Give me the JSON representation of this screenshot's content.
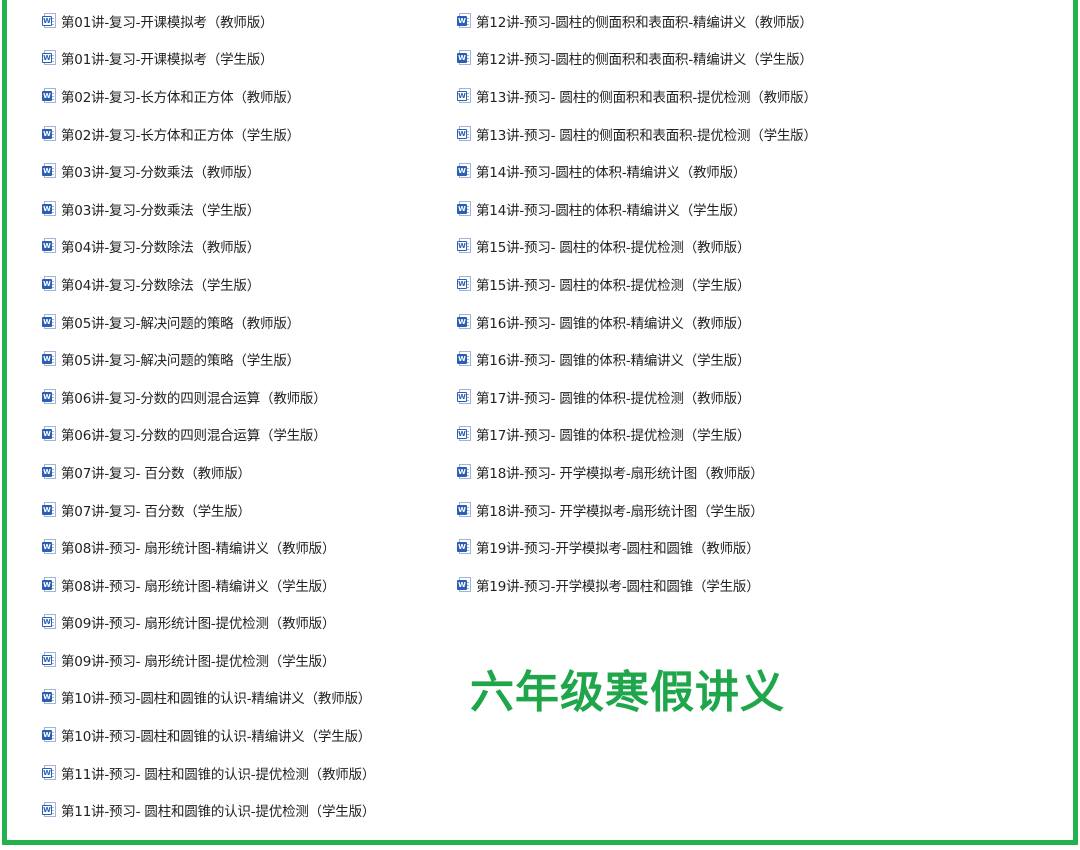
{
  "frame": {
    "border_color": "#22b14c"
  },
  "headline": {
    "text": "六年级寒假讲义",
    "color": "#1fa64a"
  },
  "files": {
    "left": [
      {
        "name": "第01讲-复习-开课模拟考（教师版）",
        "icon": "word-doc-icon-light"
      },
      {
        "name": "第01讲-复习-开课模拟考（学生版）",
        "icon": "word-doc-icon-light"
      },
      {
        "name": "第02讲-复习-长方体和正方体（教师版）",
        "icon": "word-doc-icon"
      },
      {
        "name": "第02讲-复习-长方体和正方体（学生版）",
        "icon": "word-doc-icon"
      },
      {
        "name": "第03讲-复习-分数乘法（教师版）",
        "icon": "word-doc-icon"
      },
      {
        "name": "第03讲-复习-分数乘法（学生版）",
        "icon": "word-doc-icon"
      },
      {
        "name": "第04讲-复习-分数除法（教师版）",
        "icon": "word-doc-icon"
      },
      {
        "name": "第04讲-复习-分数除法（学生版）",
        "icon": "word-doc-icon"
      },
      {
        "name": "第05讲-复习-解决问题的策略（教师版）",
        "icon": "word-doc-icon"
      },
      {
        "name": "第05讲-复习-解决问题的策略（学生版）",
        "icon": "word-doc-icon"
      },
      {
        "name": "第06讲-复习-分数的四则混合运算（教师版）",
        "icon": "word-doc-icon"
      },
      {
        "name": "第06讲-复习-分数的四则混合运算（学生版）",
        "icon": "word-doc-icon"
      },
      {
        "name": "第07讲-复习- 百分数（教师版）",
        "icon": "word-doc-icon"
      },
      {
        "name": "第07讲-复习- 百分数（学生版）",
        "icon": "word-doc-icon"
      },
      {
        "name": "第08讲-预习- 扇形统计图-精编讲义（教师版）",
        "icon": "word-doc-icon"
      },
      {
        "name": "第08讲-预习- 扇形统计图-精编讲义（学生版）",
        "icon": "word-doc-icon"
      },
      {
        "name": "第09讲-预习- 扇形统计图-提优检测（教师版）",
        "icon": "word-doc-icon-light"
      },
      {
        "name": "第09讲-预习- 扇形统计图-提优检测（学生版）",
        "icon": "word-doc-icon-light"
      },
      {
        "name": "第10讲-预习-圆柱和圆锥的认识-精编讲义（教师版）",
        "icon": "word-doc-icon"
      },
      {
        "name": "第10讲-预习-圆柱和圆锥的认识-精编讲义（学生版）",
        "icon": "word-doc-icon"
      },
      {
        "name": "第11讲-预习- 圆柱和圆锥的认识-提优检测（教师版）",
        "icon": "word-doc-icon-light"
      },
      {
        "name": "第11讲-预习- 圆柱和圆锥的认识-提优检测（学生版）",
        "icon": "word-doc-icon-light"
      }
    ],
    "right": [
      {
        "name": "第12讲-预习-圆柱的侧面积和表面积-精编讲义（教师版）",
        "icon": "word-doc-icon"
      },
      {
        "name": "第12讲-预习-圆柱的侧面积和表面积-精编讲义（学生版）",
        "icon": "word-doc-icon"
      },
      {
        "name": "第13讲-预习- 圆柱的侧面积和表面积-提优检测（教师版）",
        "icon": "word-doc-icon-light"
      },
      {
        "name": "第13讲-预习- 圆柱的侧面积和表面积-提优检测（学生版）",
        "icon": "word-doc-icon-light"
      },
      {
        "name": "第14讲-预习-圆柱的体积-精编讲义（教师版）",
        "icon": "word-doc-icon"
      },
      {
        "name": "第14讲-预习-圆柱的体积-精编讲义（学生版）",
        "icon": "word-doc-icon"
      },
      {
        "name": "第15讲-预习- 圆柱的体积-提优检测（教师版）",
        "icon": "word-doc-icon-light"
      },
      {
        "name": "第15讲-预习- 圆柱的体积-提优检测（学生版）",
        "icon": "word-doc-icon-light"
      },
      {
        "name": "第16讲-预习- 圆锥的体积-精编讲义（教师版）",
        "icon": "word-doc-icon"
      },
      {
        "name": "第16讲-预习- 圆锥的体积-精编讲义（学生版）",
        "icon": "word-doc-icon"
      },
      {
        "name": "第17讲-预习- 圆锥的体积-提优检测（教师版）",
        "icon": "word-doc-icon-light"
      },
      {
        "name": "第17讲-预习- 圆锥的体积-提优检测（学生版）",
        "icon": "word-doc-icon-light"
      },
      {
        "name": "第18讲-预习- 开学模拟考-扇形统计图（教师版）",
        "icon": "word-doc-icon"
      },
      {
        "name": "第18讲-预习- 开学模拟考-扇形统计图（学生版）",
        "icon": "word-doc-icon"
      },
      {
        "name": "第19讲-预习-开学模拟考-圆柱和圆锥（教师版）",
        "icon": "word-doc-icon"
      },
      {
        "name": "第19讲-预习-开学模拟考-圆柱和圆锥（学生版）",
        "icon": "word-doc-icon"
      }
    ]
  }
}
